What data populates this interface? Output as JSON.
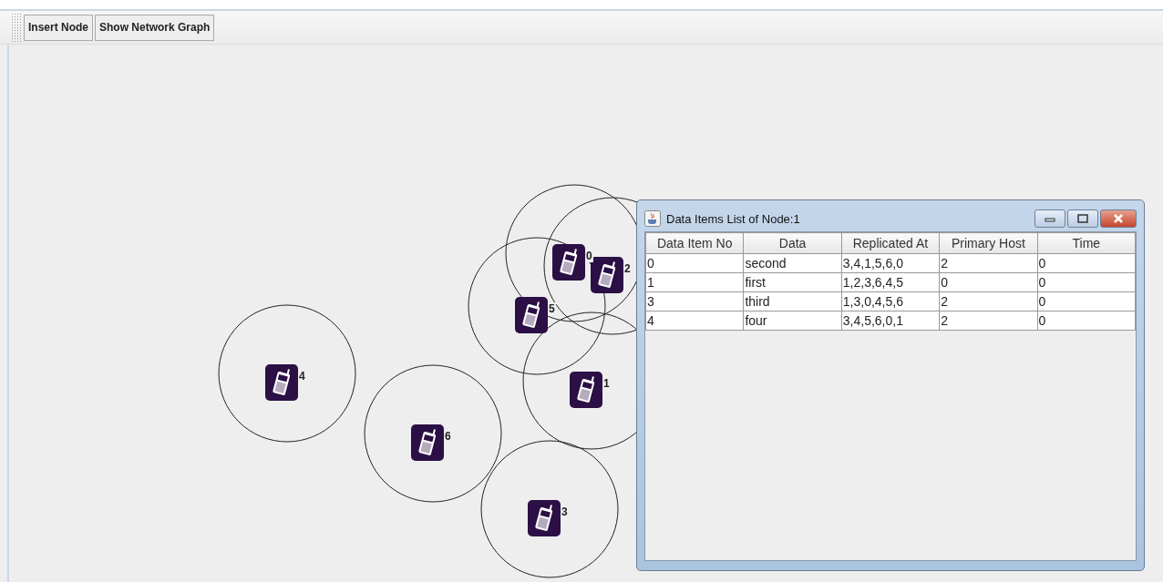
{
  "toolbar": {
    "buttons": [
      "Insert Node",
      "Show Network Graph"
    ]
  },
  "nodes": [
    {
      "label": "0"
    },
    {
      "label": "2"
    },
    {
      "label": "5"
    },
    {
      "label": "1"
    },
    {
      "label": "4"
    },
    {
      "label": "6"
    },
    {
      "label": "3"
    }
  ],
  "dialog": {
    "title": "Data Items List of Node:1",
    "table": {
      "columns": [
        "Data Item No",
        "Data",
        "Replicated At",
        "Primary Host",
        "Time"
      ],
      "rows": [
        [
          "0",
          "second",
          "3,4,1,5,6,0",
          "2",
          "0"
        ],
        [
          "1",
          "first",
          "1,2,3,6,4,5",
          "0",
          "0"
        ],
        [
          "3",
          "third",
          "1,3,0,4,5,6",
          "2",
          "0"
        ],
        [
          "4",
          "four",
          "3,4,5,6,0,1",
          "2",
          "0"
        ]
      ]
    }
  }
}
